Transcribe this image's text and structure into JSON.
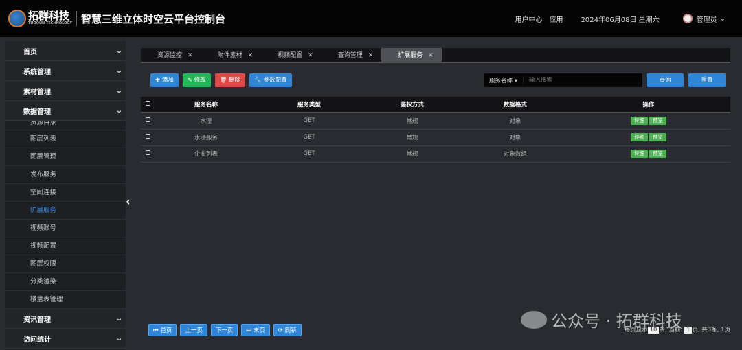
{
  "header": {
    "logo_text": "拓群科技",
    "logo_sub": "TUOQUN TECHNOLOGY",
    "title": "智慧三维立体时空云平台控制台",
    "links": [
      "用户中心",
      "应用"
    ],
    "date": "2024年06月08日 星期六",
    "user": "管理员"
  },
  "sidebar": {
    "top": [
      "首页",
      "系统管理",
      "素材管理",
      "数据管理"
    ],
    "sub": [
      {
        "label": "资源目录",
        "active": false
      },
      {
        "label": "图层列表",
        "active": false
      },
      {
        "label": "图层管理",
        "active": false
      },
      {
        "label": "发布服务",
        "active": false
      },
      {
        "label": "空间连接",
        "active": false
      },
      {
        "label": "扩展服务",
        "active": true
      },
      {
        "label": "视频账号",
        "active": false
      },
      {
        "label": "视频配置",
        "active": false
      },
      {
        "label": "图层权限",
        "active": false
      },
      {
        "label": "分类渲染",
        "active": false
      },
      {
        "label": "楼盘表管理",
        "active": false
      }
    ],
    "bottom": [
      "资讯管理",
      "访问统计"
    ]
  },
  "tabs": [
    {
      "label": "资源监控"
    },
    {
      "label": "附件素材"
    },
    {
      "label": "视频配置"
    },
    {
      "label": "查询管理"
    },
    {
      "label": "扩展服务",
      "active": true
    }
  ],
  "toolbar": {
    "add": "添加",
    "edit": "修改",
    "delete": "删除",
    "config": "参数配置"
  },
  "search": {
    "field": "服务名称",
    "placeholder": "输入搜索",
    "query": "查询",
    "reset": "重置"
  },
  "table": {
    "headers": [
      "服务名称",
      "服务类型",
      "鉴权方式",
      "数据格式",
      "操作"
    ],
    "rows": [
      [
        "水浸",
        "GET",
        "常规",
        "对象"
      ],
      [
        "水浸服务",
        "GET",
        "常规",
        "对象"
      ],
      [
        "企业列表",
        "GET",
        "常规",
        "对象数组"
      ]
    ],
    "actions": [
      "详细",
      "预览"
    ]
  },
  "pager": {
    "buttons": [
      "首页",
      "上一页",
      "下一页",
      "末页",
      "刷新"
    ],
    "info_prefix": "每页显示",
    "page_size": "10",
    "info_mid": "条, 当前:",
    "current": "1",
    "info_suffix": "页, 共3条, 1页"
  },
  "watermark": "公众号 · 拓群科技",
  "colors": {
    "primary": "#2f86d9",
    "success": "#22b85a",
    "danger": "#e04848",
    "tag": "#4caf50"
  }
}
